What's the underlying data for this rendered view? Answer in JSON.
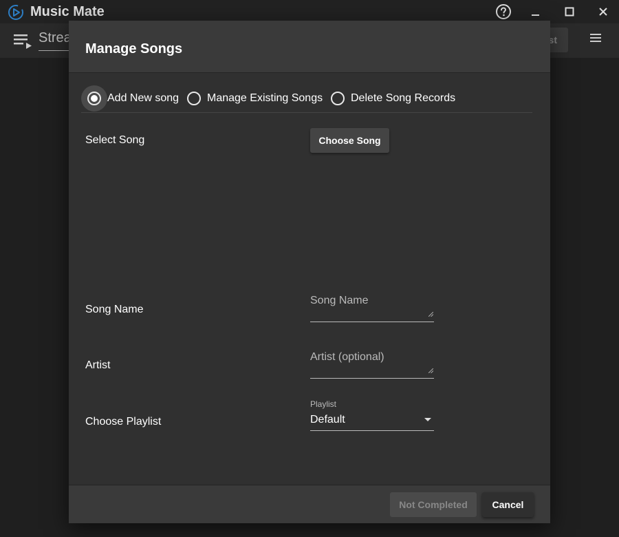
{
  "window": {
    "title": "Music Mate"
  },
  "appbar": {
    "stream_text": "Strea",
    "partial_button_text": "st"
  },
  "dialog": {
    "title": "Manage Songs",
    "modes": [
      {
        "label": "Add New song",
        "selected": true
      },
      {
        "label": "Manage Existing Songs",
        "selected": false
      },
      {
        "label": "Delete Song Records",
        "selected": false
      }
    ],
    "select_song": {
      "label": "Select Song",
      "button_label": "Choose Song"
    },
    "song_name": {
      "label": "Song Name",
      "placeholder": "Song Name"
    },
    "artist": {
      "label": "Artist",
      "placeholder": "Artist (optional)"
    },
    "playlist": {
      "label": "Choose Playlist",
      "field_label": "Playlist",
      "selected": "Default"
    },
    "footer": {
      "not_completed_label": "Not Completed",
      "cancel_label": "Cancel"
    }
  },
  "icons": {
    "logo": "music-play-logo-icon",
    "help": "help-circle-icon",
    "minimize": "minimize-icon",
    "maximize": "maximize-icon",
    "close": "close-icon",
    "queue": "playlist-queue-icon",
    "menu": "hamburger-menu-icon"
  },
  "colors": {
    "background": "#1c1c1c",
    "dialog": "#303030",
    "dialog_bar": "#3a3a3a",
    "logo_accent": "#2d7ec4"
  }
}
